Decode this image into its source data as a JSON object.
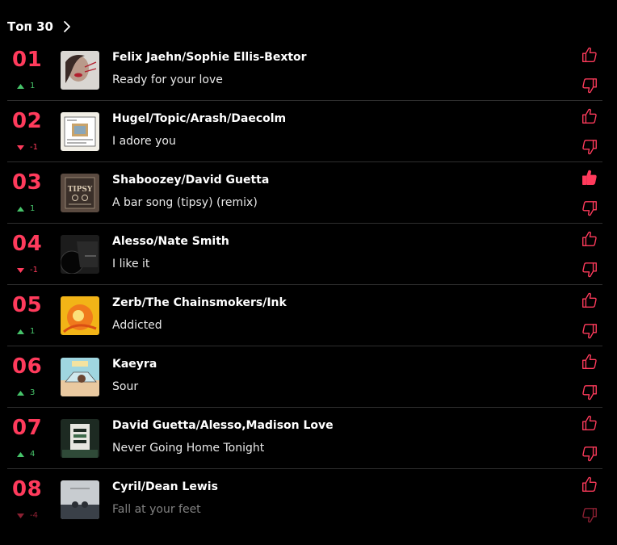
{
  "header": {
    "title": "Топ 30"
  },
  "colors": {
    "accent": "#ff3b5c",
    "up": "#46c46a",
    "down": "#ff3b5c"
  },
  "tracks": [
    {
      "rank": "01",
      "trend": "up",
      "change": "1",
      "artist": "Felix Jaehn/Sophie Ellis-Bextor",
      "title": "Ready for your love",
      "liked": false
    },
    {
      "rank": "02",
      "trend": "down",
      "change": "-1",
      "artist": "Hugel/Topic/Arash/Daecolm",
      "title": "I adore you",
      "liked": false
    },
    {
      "rank": "03",
      "trend": "up",
      "change": "1",
      "artist": "Shaboozey/David Guetta",
      "title": "A bar song (tipsy) (remix)",
      "liked": true
    },
    {
      "rank": "04",
      "trend": "down",
      "change": "-1",
      "artist": "Alesso/Nate Smith",
      "title": "I like it",
      "liked": false
    },
    {
      "rank": "05",
      "trend": "up",
      "change": "1",
      "artist": "Zerb/The Chainsmokers/Ink",
      "title": "Addicted",
      "liked": false
    },
    {
      "rank": "06",
      "trend": "up",
      "change": "3",
      "artist": "Kaeyra",
      "title": "Sour",
      "liked": false
    },
    {
      "rank": "07",
      "trend": "up",
      "change": "4",
      "artist": "David Guetta/Alesso,Madison Love",
      "title": "Never Going Home Tonight",
      "liked": false
    },
    {
      "rank": "08",
      "trend": "down",
      "change": "-4",
      "artist": "Cyril/Dean Lewis",
      "title": "Fall at your feet",
      "liked": false
    }
  ]
}
